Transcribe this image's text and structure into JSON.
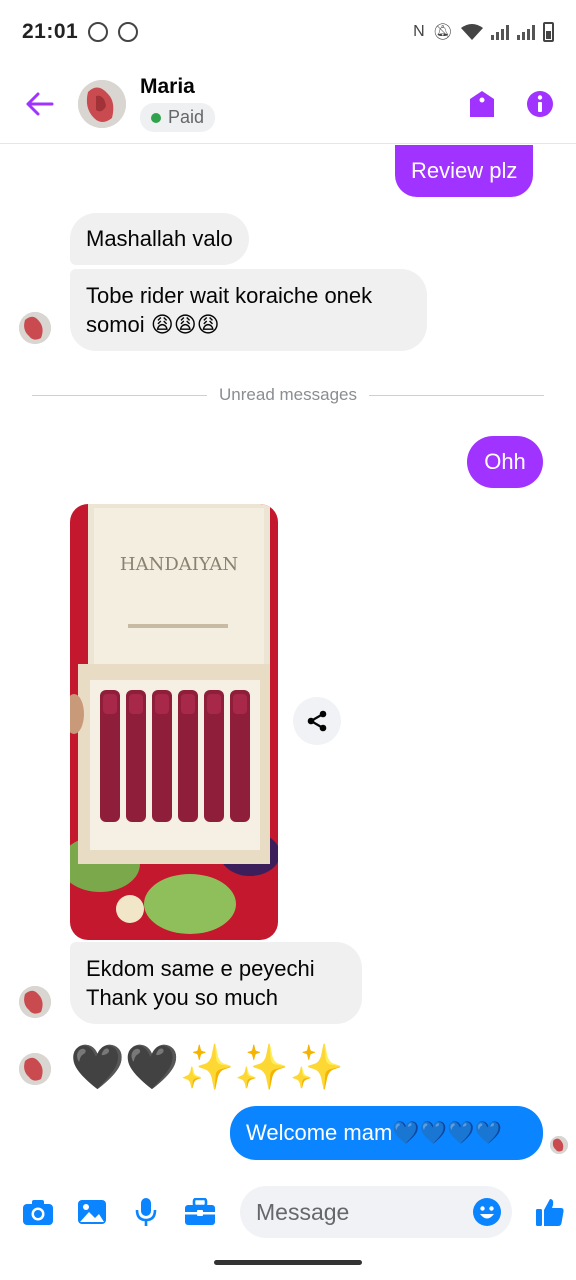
{
  "status_bar": {
    "time": "21:01"
  },
  "header": {
    "contact_name": "Maria",
    "badge_label": "Paid",
    "back_icon": "arrow-left-icon",
    "tag_icon": "tag-icon",
    "info_icon": "info-icon"
  },
  "messages": {
    "review": "Review plz",
    "mashallah": "Mashallah valo",
    "tobe_line1": "Tobe rider wait koraiche onek",
    "tobe_line2": "somoi 😩😩😩",
    "divider": "Unread messages",
    "ohh": "Ohh",
    "photo_brand": "HANDAIYAN",
    "ekdom_line1": "Ekdom same e peyechi",
    "ekdom_line2": "Thank you so much",
    "emoji_msg": "🖤🖤✨✨✨",
    "welcome": "Welcome mam💙💙💙💙"
  },
  "composer": {
    "placeholder": "Message",
    "icons": [
      "camera-icon",
      "image-icon",
      "microphone-icon",
      "briefcase-icon",
      "emoji-icon",
      "thumbs-up-icon"
    ]
  },
  "colors": {
    "accent_purple": "#a033ff",
    "accent_blue": "#0a84ff",
    "incoming_bubble": "#f0f0f0",
    "paid_green": "#31a24c"
  }
}
